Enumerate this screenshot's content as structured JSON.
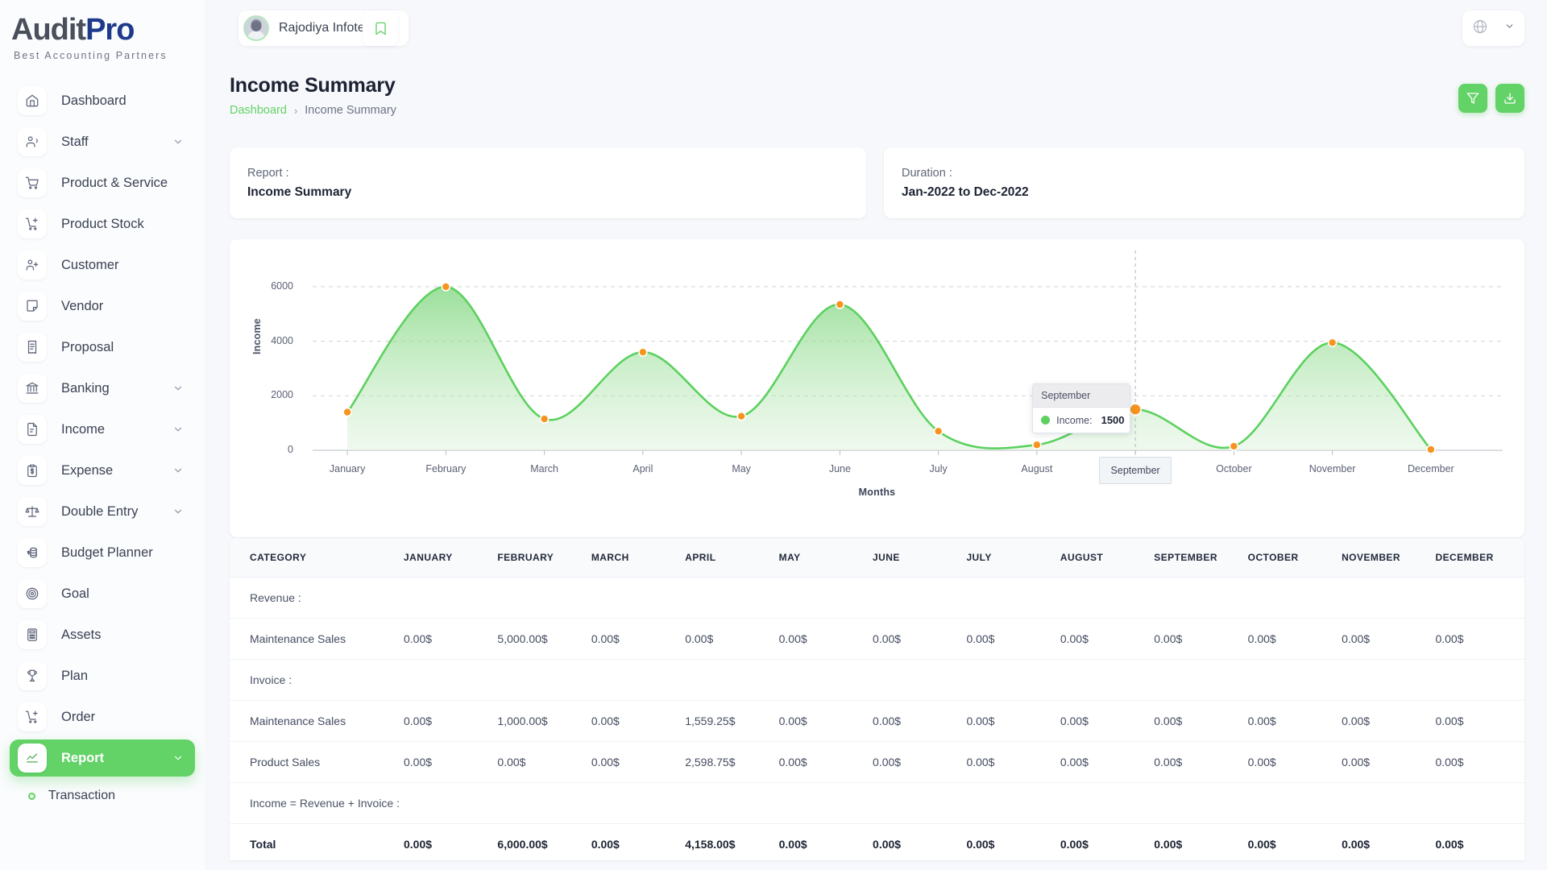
{
  "brand": {
    "name_a": "Audit",
    "name_b": "Pro",
    "tagline": "Best Accounting Partners"
  },
  "topbar": {
    "org_name": "Rajodiya Infotech",
    "bookmark_icon": "bookmark-icon",
    "globe_icon": "globe-icon",
    "chevron_icon": "chevron-down-icon"
  },
  "sidebar": {
    "items": [
      {
        "label": "Dashboard",
        "icon": "home-icon",
        "expandable": false,
        "active": false
      },
      {
        "label": "Staff",
        "icon": "users-icon",
        "expandable": true,
        "active": false
      },
      {
        "label": "Product & Service",
        "icon": "cart-icon",
        "expandable": false,
        "active": false
      },
      {
        "label": "Product Stock",
        "icon": "cart-plus-icon",
        "expandable": false,
        "active": false
      },
      {
        "label": "Customer",
        "icon": "user-plus-icon",
        "expandable": false,
        "active": false
      },
      {
        "label": "Vendor",
        "icon": "note-icon",
        "expandable": false,
        "active": false
      },
      {
        "label": "Proposal",
        "icon": "receipt-icon",
        "expandable": false,
        "active": false
      },
      {
        "label": "Banking",
        "icon": "bank-icon",
        "expandable": true,
        "active": false
      },
      {
        "label": "Income",
        "icon": "file-dollar-icon",
        "expandable": true,
        "active": false
      },
      {
        "label": "Expense",
        "icon": "clipboard-dollar-icon",
        "expandable": true,
        "active": false
      },
      {
        "label": "Double Entry",
        "icon": "scales-icon",
        "expandable": true,
        "active": false
      },
      {
        "label": "Budget Planner",
        "icon": "coins-icon",
        "expandable": false,
        "active": false
      },
      {
        "label": "Goal",
        "icon": "target-icon",
        "expandable": false,
        "active": false
      },
      {
        "label": "Assets",
        "icon": "calculator-icon",
        "expandable": false,
        "active": false
      },
      {
        "label": "Plan",
        "icon": "trophy-icon",
        "expandable": false,
        "active": false
      },
      {
        "label": "Order",
        "icon": "cart-plus-icon",
        "expandable": false,
        "active": false
      },
      {
        "label": "Report",
        "icon": "chart-line-icon",
        "expandable": true,
        "active": true
      }
    ],
    "sub_items": [
      {
        "label": "Transaction"
      }
    ]
  },
  "page": {
    "title": "Income Summary",
    "breadcrumb": {
      "root": "Dashboard",
      "separator": "›",
      "current": "Income Summary"
    },
    "actions": [
      {
        "name": "filter-button",
        "icon": "filter-icon"
      },
      {
        "name": "download-button",
        "icon": "download-icon"
      }
    ]
  },
  "info_cards": [
    {
      "label": "Report :",
      "value": "Income Summary"
    },
    {
      "label": "Duration :",
      "value": "Jan-2022 to Dec-2022"
    }
  ],
  "chart_data": {
    "type": "area",
    "title": "",
    "xlabel": "Months",
    "ylabel": "Income",
    "categories": [
      "January",
      "February",
      "March",
      "April",
      "May",
      "June",
      "July",
      "August",
      "September",
      "October",
      "November",
      "December"
    ],
    "series": [
      {
        "name": "Income",
        "color": "#5cd15f",
        "values": [
          1400,
          6000,
          1150,
          3600,
          1250,
          5350,
          700,
          200,
          1500,
          150,
          3950,
          30
        ]
      }
    ],
    "ylim": [
      0,
      6500
    ],
    "yticks": [
      0,
      2000,
      4000,
      6000
    ],
    "grid": true,
    "marker_color": "#f7941e",
    "legend": "none",
    "active_point": {
      "category": "September",
      "series_name": "Income:",
      "value": "1500",
      "dot_color": "#5cd15f"
    }
  },
  "table": {
    "columns": [
      "CATEGORY",
      "JANUARY",
      "FEBRUARY",
      "MARCH",
      "APRIL",
      "MAY",
      "JUNE",
      "JULY",
      "AUGUST",
      "SEPTEMBER",
      "OCTOBER",
      "NOVEMBER",
      "DECEMBER"
    ],
    "rows": [
      {
        "type": "section",
        "cells": [
          "Revenue :",
          "",
          "",
          "",
          "",
          "",
          "",
          "",
          "",
          "",
          "",
          "",
          ""
        ]
      },
      {
        "type": "data",
        "cells": [
          "Maintenance Sales",
          "0.00$",
          "5,000.00$",
          "0.00$",
          "0.00$",
          "0.00$",
          "0.00$",
          "0.00$",
          "0.00$",
          "0.00$",
          "0.00$",
          "0.00$",
          "0.00$"
        ]
      },
      {
        "type": "section",
        "cells": [
          "Invoice :",
          "",
          "",
          "",
          "",
          "",
          "",
          "",
          "",
          "",
          "",
          "",
          ""
        ]
      },
      {
        "type": "data",
        "cells": [
          "Maintenance Sales",
          "0.00$",
          "1,000.00$",
          "0.00$",
          "1,559.25$",
          "0.00$",
          "0.00$",
          "0.00$",
          "0.00$",
          "0.00$",
          "0.00$",
          "0.00$",
          "0.00$"
        ]
      },
      {
        "type": "data",
        "cells": [
          "Product Sales",
          "0.00$",
          "0.00$",
          "0.00$",
          "2,598.75$",
          "0.00$",
          "0.00$",
          "0.00$",
          "0.00$",
          "0.00$",
          "0.00$",
          "0.00$",
          "0.00$"
        ]
      },
      {
        "type": "section",
        "cells": [
          "Income = Revenue + Invoice :",
          "",
          "",
          "",
          "",
          "",
          "",
          "",
          "",
          "",
          "",
          "",
          ""
        ]
      },
      {
        "type": "total",
        "cells": [
          "Total",
          "0.00$",
          "6,000.00$",
          "0.00$",
          "4,158.00$",
          "0.00$",
          "0.00$",
          "0.00$",
          "0.00$",
          "0.00$",
          "0.00$",
          "0.00$",
          "0.00$"
        ]
      }
    ]
  },
  "colors": {
    "accent": "#63d267",
    "brand_dark": "#4a4f5c",
    "brand_blue": "#1e3a8a",
    "marker": "#f7941e"
  }
}
